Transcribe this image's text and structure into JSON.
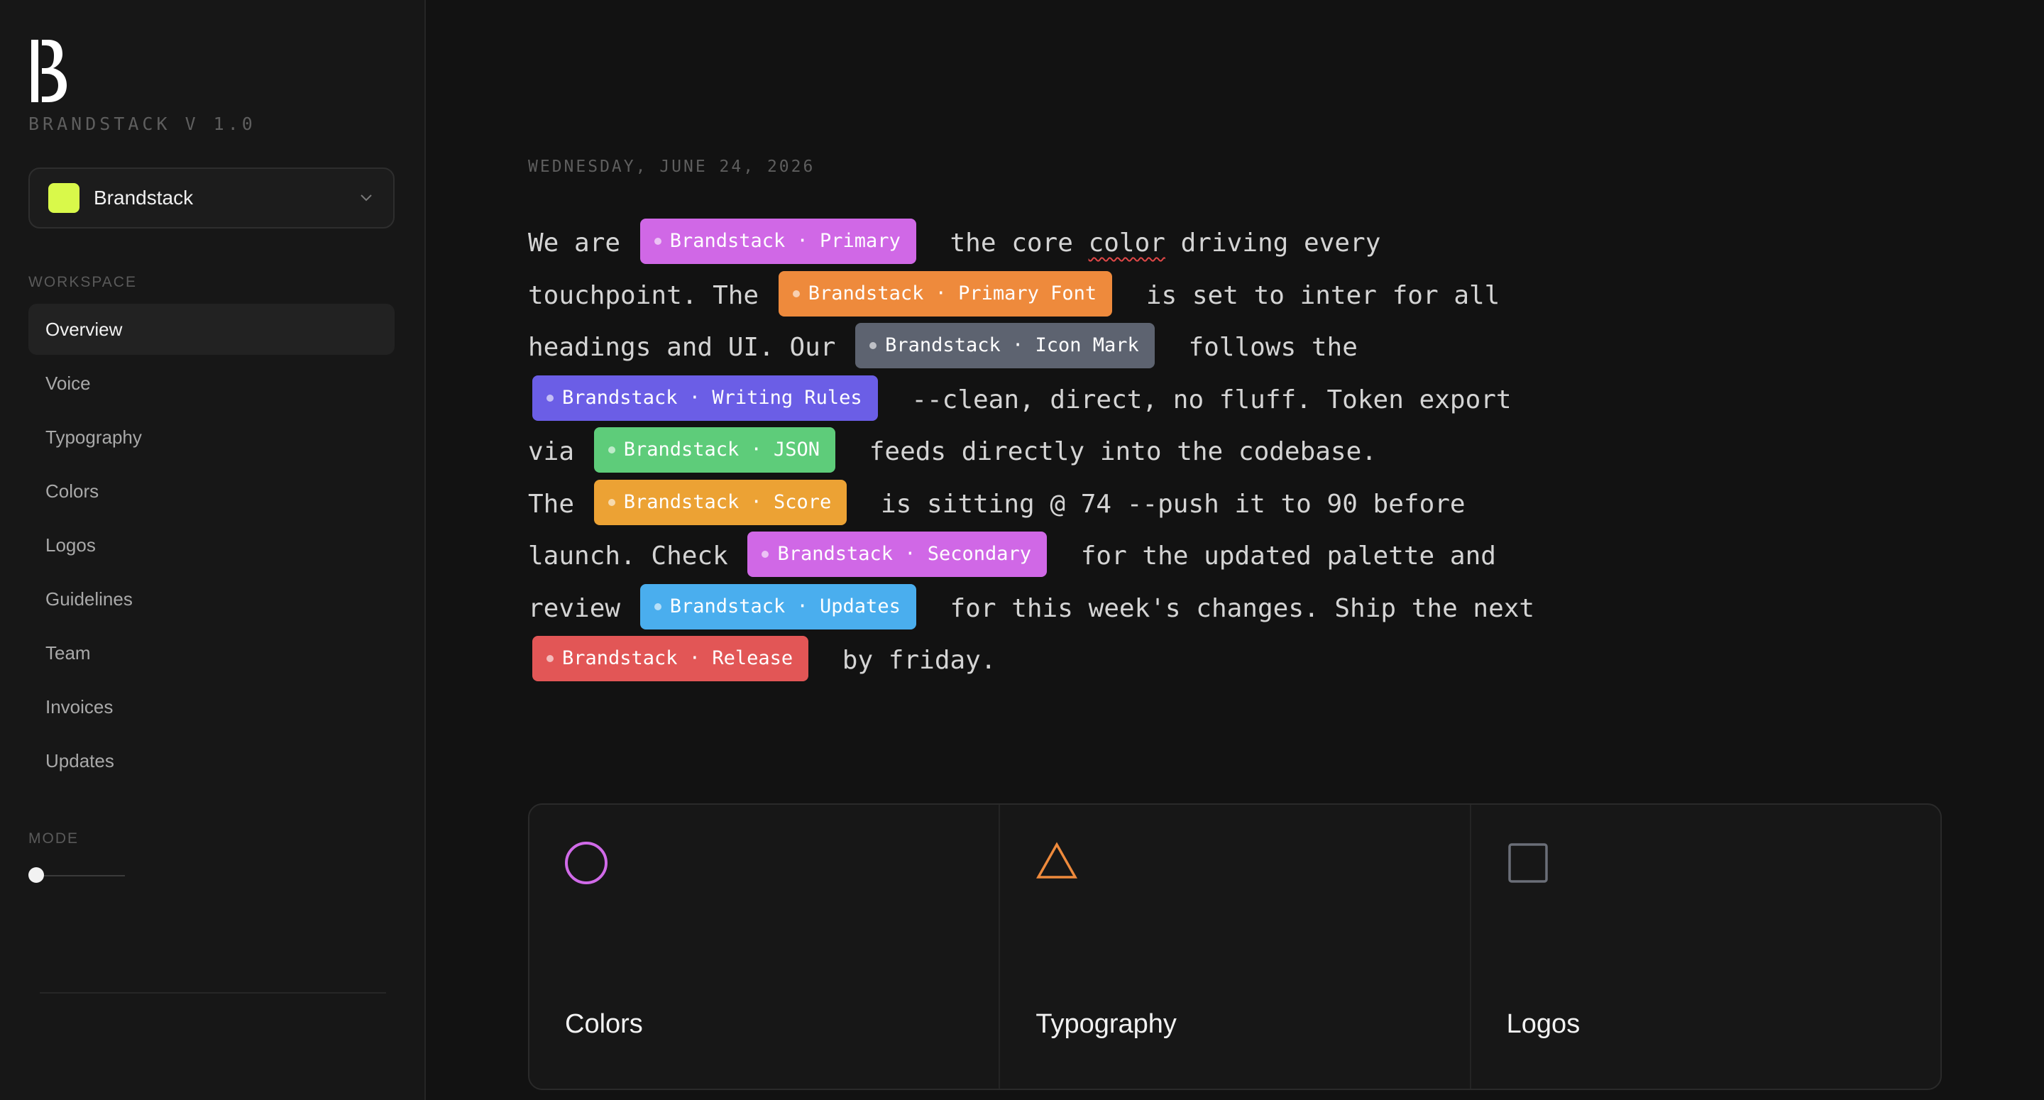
{
  "sidebar": {
    "version_label": "BRANDSTACK V 1.0",
    "workspace_select": {
      "name": "Brandstack",
      "swatch_color": "#d9f94a"
    },
    "workspace_section_label": "WORKSPACE",
    "nav_items": [
      {
        "label": "Overview",
        "active": true
      },
      {
        "label": "Voice"
      },
      {
        "label": "Typography"
      },
      {
        "label": "Colors"
      },
      {
        "label": "Logos"
      },
      {
        "label": "Guidelines"
      },
      {
        "label": "Team"
      },
      {
        "label": "Invoices"
      },
      {
        "label": "Updates"
      }
    ],
    "mode_section_label": "MODE"
  },
  "main": {
    "date": "WEDNESDAY, JUNE 24, 2026",
    "prose": {
      "t0": "We are ",
      "t1": " the core ",
      "t1b": "color",
      "t1c": " driving every touchpoint. The ",
      "t2": " is set to inter for all headings and UI. Our ",
      "t3": " follows the ",
      "t4": " --clean, direct, no fluff. Token export via ",
      "t5": " feeds directly into the codebase.",
      "t6": "The ",
      "t7": " is sitting @ 74 --push it to 90 before launch. Check ",
      "t8": " for the updated palette and review ",
      "t9": " for this week's changes. Ship the next ",
      "t10": " by friday."
    },
    "tags": [
      {
        "label": "Brandstack · Primary",
        "color": "#d068e6"
      },
      {
        "label": "Brandstack · Primary Font",
        "color": "#ee8a3c"
      },
      {
        "label": "Brandstack · Icon Mark",
        "color": "#5d6370"
      },
      {
        "label": "Brandstack · Writing Rules",
        "color": "#6b5ee6"
      },
      {
        "label": "Brandstack · JSON",
        "color": "#5ecc7a"
      },
      {
        "label": "Brandstack · Score",
        "color": "#eca234"
      },
      {
        "label": "Brandstack · Secondary",
        "color": "#d068e6"
      },
      {
        "label": "Brandstack · Updates",
        "color": "#4aaeee"
      },
      {
        "label": "Brandstack · Release",
        "color": "#e25656"
      }
    ],
    "cards": [
      {
        "title": "Colors",
        "icon": "circle-icon",
        "icon_color": "#d06ae8"
      },
      {
        "title": "Typography",
        "icon": "triangle-icon",
        "icon_color": "#ee8a3c"
      },
      {
        "title": "Logos",
        "icon": "square-icon",
        "icon_color": "#6b6f78"
      }
    ]
  }
}
